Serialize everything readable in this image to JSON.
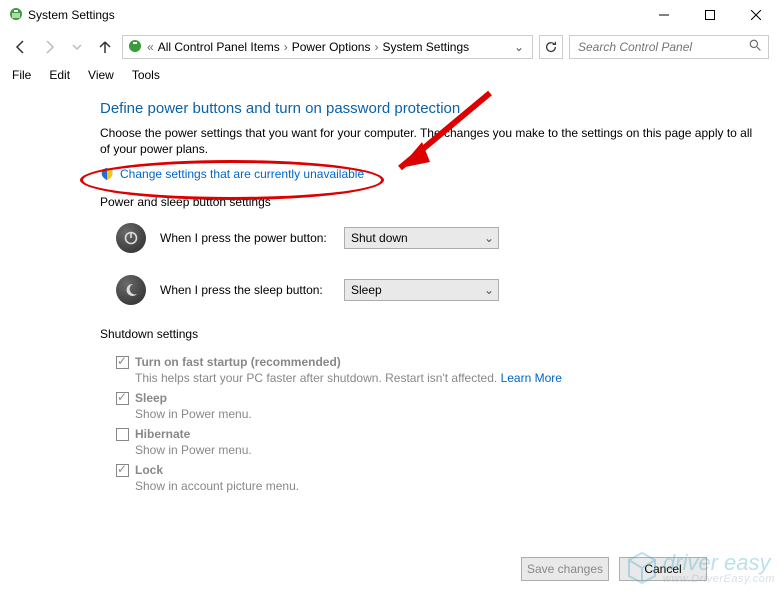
{
  "window": {
    "title": "System Settings"
  },
  "breadcrumb": {
    "items": [
      "All Control Panel Items",
      "Power Options",
      "System Settings"
    ]
  },
  "search": {
    "placeholder": "Search Control Panel"
  },
  "menubar": [
    "File",
    "Edit",
    "View",
    "Tools"
  ],
  "page": {
    "heading": "Define power buttons and turn on password protection",
    "subtext": "Choose the power settings that you want for your computer. The changes you make to the settings on this page apply to all of your power plans.",
    "change_link": "Change settings that are currently unavailable",
    "section_power_sleep": "Power and sleep button settings",
    "power_button_label": "When I press the power button:",
    "power_button_value": "Shut down",
    "sleep_button_label": "When I press the sleep button:",
    "sleep_button_value": "Sleep",
    "section_shutdown": "Shutdown settings",
    "fast_startup": {
      "label": "Turn on fast startup (recommended)",
      "sub": "This helps start your PC faster after shutdown. Restart isn't affected. ",
      "learn_more": "Learn More"
    },
    "sleep": {
      "label": "Sleep",
      "sub": "Show in Power menu."
    },
    "hibernate": {
      "label": "Hibernate",
      "sub": "Show in Power menu."
    },
    "lock": {
      "label": "Lock",
      "sub": "Show in account picture menu."
    }
  },
  "footer": {
    "save": "Save changes",
    "cancel": "Cancel"
  },
  "watermark": {
    "main": "driver easy",
    "sub": "www.DriverEasy.com"
  }
}
